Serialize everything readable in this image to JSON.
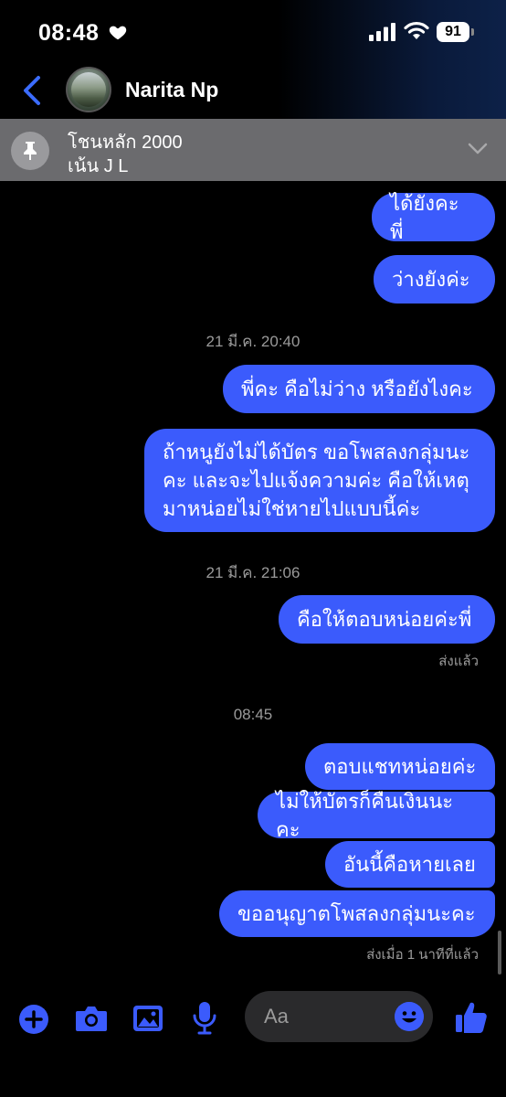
{
  "status_bar": {
    "time": "08:48",
    "battery": "91"
  },
  "header": {
    "contact_name": "Narita Np"
  },
  "pinned": {
    "line1": "โชนหลัก 2000",
    "line2": "เน้น J L"
  },
  "messages": [
    {
      "text": "ได้ยังคะ พี่"
    },
    {
      "text": "ว่างยังค่ะ"
    },
    {
      "timestamp": "21 มี.ค. 20:40"
    },
    {
      "text": "พี่คะ คือไม่ว่าง หรือยังไงคะ"
    },
    {
      "lines": [
        "ถ้าหนูยังไม่ได้บัตร ขอโพสลงกลุ่มนะ",
        "คะ และจะไปแจ้งความค่ะ คือให้เหตุ",
        "มาหน่อยไม่ใช่หายไปแบบนี้ค่ะ"
      ]
    },
    {
      "timestamp": "21 มี.ค. 21:06"
    },
    {
      "text": "คือให้ตอบหน่อยค่ะพี่"
    },
    {
      "receipt": "ส่งแล้ว"
    },
    {
      "timestamp": "08:45"
    },
    {
      "text": "ตอบแชทหน่อยค่ะ"
    },
    {
      "text": "ไม่ให้บัตรก็คืนเงินนะคะ"
    },
    {
      "text": "อันนี้คือหายเลย"
    },
    {
      "text": "ขออนุญาตโพสลงกลุ่มนะคะ"
    },
    {
      "receipt": "ส่งเมื่อ 1 นาทีที่แล้ว"
    }
  ],
  "composer": {
    "placeholder": "Aa"
  },
  "colors": {
    "accent": "#3b5bfc",
    "background": "#000000",
    "pinned_bg": "#6b6b6e"
  },
  "icons": [
    "heart-icon",
    "signal-icon",
    "wifi-icon",
    "back-chevron-icon",
    "pin-icon",
    "chevron-down-icon",
    "plus-icon",
    "camera-icon",
    "image-icon",
    "microphone-icon",
    "emoji-icon",
    "thumbs-up-icon"
  ]
}
